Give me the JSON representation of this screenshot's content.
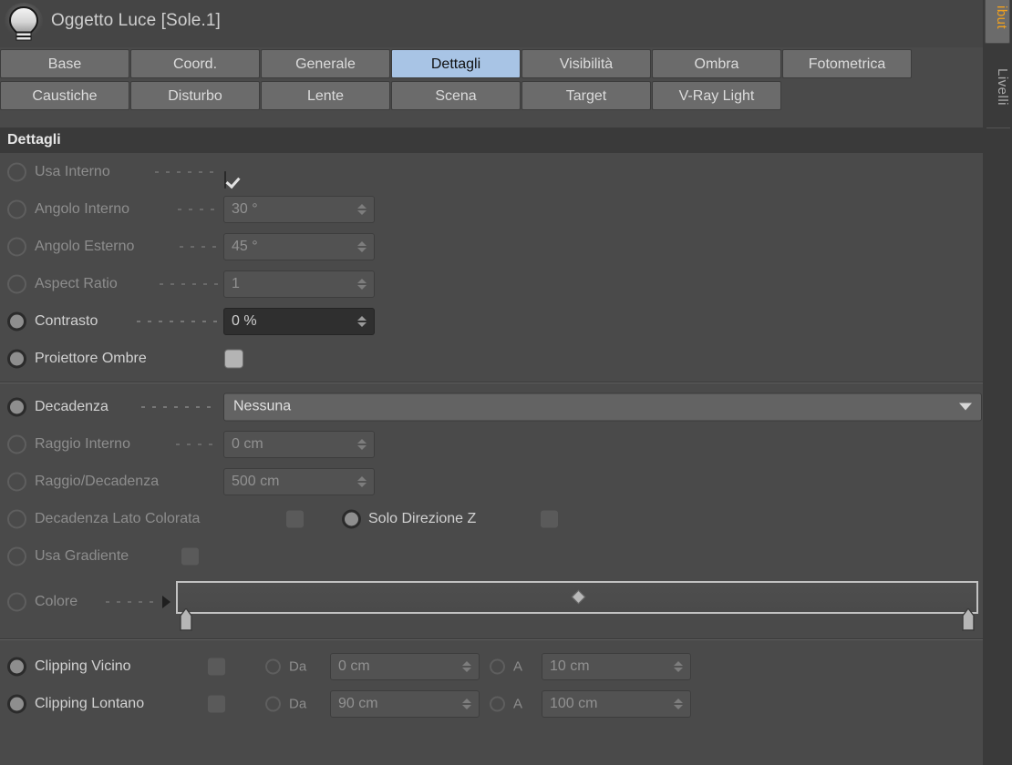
{
  "window": {
    "icon": "light-bulb-icon",
    "title": "Oggetto Luce [Sole.1]"
  },
  "tabs": {
    "row1": [
      {
        "label": "Base",
        "active": false
      },
      {
        "label": "Coord.",
        "active": false
      },
      {
        "label": "Generale",
        "active": false
      },
      {
        "label": "Dettagli",
        "active": true
      },
      {
        "label": "Visibilità",
        "active": false
      },
      {
        "label": "Ombra",
        "active": false
      },
      {
        "label": "Fotometrica",
        "active": false
      }
    ],
    "row2": [
      {
        "label": "Caustiche",
        "active": false
      },
      {
        "label": "Disturbo",
        "active": false
      },
      {
        "label": "Lente",
        "active": false
      },
      {
        "label": "Scena",
        "active": false
      },
      {
        "label": "Target",
        "active": false
      },
      {
        "label": "V-Ray Light",
        "active": false
      }
    ]
  },
  "section": {
    "title": "Dettagli"
  },
  "fields": {
    "usa_interno": {
      "label": "Usa Interno",
      "value": "checked",
      "enabled": false
    },
    "angolo_interno": {
      "label": "Angolo Interno",
      "value": "30 °",
      "enabled": false
    },
    "angolo_esterno": {
      "label": "Angolo Esterno",
      "value": "45 °",
      "enabled": false
    },
    "aspect_ratio": {
      "label": "Aspect Ratio",
      "value": "1",
      "enabled": false
    },
    "contrasto": {
      "label": "Contrasto",
      "value": "0 %",
      "enabled": true
    },
    "proiettore_ombre": {
      "label": "Proiettore Ombre",
      "value": "unchecked",
      "enabled": true
    },
    "decadenza": {
      "label": "Decadenza",
      "value": "Nessuna",
      "enabled": true
    },
    "raggio_interno": {
      "label": "Raggio Interno",
      "value": "0 cm",
      "enabled": false
    },
    "raggio_decadenza": {
      "label": "Raggio/Decadenza",
      "value": "500 cm",
      "enabled": false
    },
    "decadenza_lato_colorata": {
      "label": "Decadenza Lato Colorata",
      "value": "unchecked",
      "enabled": false
    },
    "solo_direzione_z": {
      "label": "Solo Direzione Z",
      "value": "unchecked",
      "enabled": true
    },
    "usa_gradiente": {
      "label": "Usa Gradiente",
      "value": "unchecked",
      "enabled": false
    },
    "colore": {
      "label": "Colore",
      "enabled": false
    },
    "clipping_vicino": {
      "label": "Clipping Vicino",
      "enabled": true,
      "checkbox": "unchecked",
      "from_label": "Da",
      "from_value": "0 cm",
      "to_label": "A",
      "to_value": "10 cm"
    },
    "clipping_lontano": {
      "label": "Clipping Lontano",
      "enabled": true,
      "checkbox": "unchecked",
      "from_label": "Da",
      "from_value": "90 cm",
      "to_label": "A",
      "to_value": "100 cm"
    }
  },
  "dock": {
    "attributes_tab": "ibut",
    "layers_tab": "Livelli"
  },
  "colors": {
    "panel_bg": "#4a4a4a",
    "tab_bg": "#6b6b6b",
    "tab_active_bg": "#a8c4e5",
    "section_header_bg": "#3a3a3a",
    "field_enabled_bg": "#2f2f2f",
    "field_disabled_bg": "#525252",
    "dropdown_bg": "#636363",
    "accent_orange": "#f0a01e",
    "text_lit": "#d2d2d2",
    "text_dim": "#8d8d8d"
  }
}
